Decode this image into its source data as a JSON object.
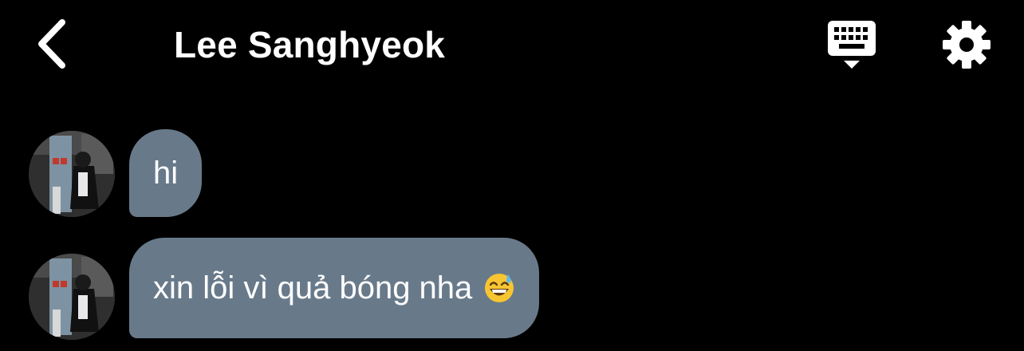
{
  "header": {
    "title": "Lee Sanghyeok",
    "back_icon": "chevron-left-icon",
    "keyboard_icon": "keyboard-icon",
    "settings_icon": "gear-icon"
  },
  "messages": [
    {
      "text": "hi",
      "avatar": "contact-avatar",
      "emoji": null
    },
    {
      "text": "xin lỗi vì quả bóng nha",
      "avatar": "contact-avatar",
      "emoji": "grinning-sweat-emoji"
    }
  ],
  "colors": {
    "background": "#000000",
    "bubble": "#687a8a",
    "text": "#ffffff"
  }
}
